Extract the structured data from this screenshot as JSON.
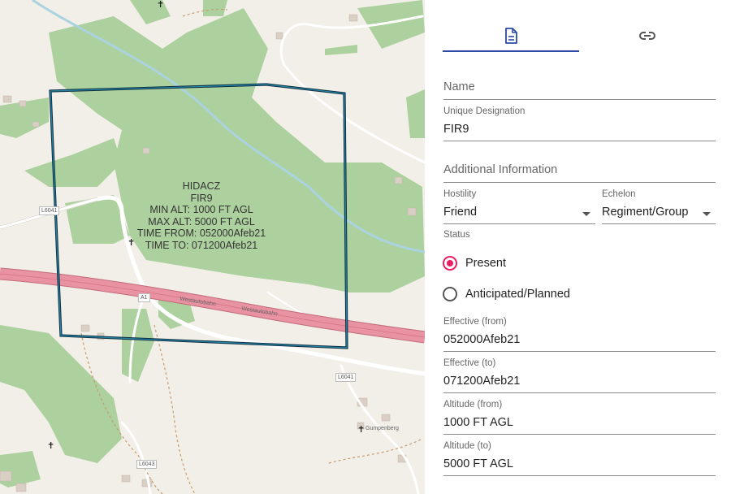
{
  "map": {
    "shape_label": {
      "name": "HIDACZ",
      "designation": "FIR9",
      "min_alt": "MIN ALT: 1000 FT AGL",
      "max_alt": "MAX ALT: 5000 FT AGL",
      "time_from": "TIME FROM: 052000Afeb21",
      "time_to": "TIME TO: 071200Afeb21"
    },
    "road_refs": [
      "L6041",
      "A1",
      "L6041",
      "L6043"
    ],
    "road_names": [
      "Westautobahn",
      "Westautobahn"
    ],
    "place": "Gumpenberg"
  },
  "tabs": [
    {
      "icon": "document-icon",
      "active": true
    },
    {
      "icon": "link-icon",
      "active": false
    }
  ],
  "form": {
    "name": {
      "placeholder": "Name",
      "value": ""
    },
    "unique_designation": {
      "label": "Unique Designation",
      "value": "FIR9"
    },
    "additional_information": {
      "placeholder": "Additional Information",
      "value": ""
    },
    "hostility": {
      "label": "Hostility",
      "value": "Friend"
    },
    "echelon": {
      "label": "Echelon",
      "value": "Regiment/Group"
    },
    "status": {
      "label": "Status",
      "options": [
        {
          "label": "Present",
          "checked": true
        },
        {
          "label": "Anticipated/Planned",
          "checked": false
        }
      ]
    },
    "effective_from": {
      "label": "Effective (from)",
      "value": "052000Afeb21"
    },
    "effective_to": {
      "label": "Effective (to)",
      "value": "071200Afeb21"
    },
    "altitude_from": {
      "label": "Altitude (from)",
      "value": "1000 FT AGL"
    },
    "altitude_to": {
      "label": "Altitude (to)",
      "value": "5000 FT AGL"
    }
  },
  "colors": {
    "accent": "#2b49a5",
    "radio_checked": "#e91e63",
    "shape_outline": "#0b4f6c",
    "forest": "#add19e",
    "motorway": "#e892a2",
    "water": "#aad3df",
    "land": "#f2efe9"
  }
}
